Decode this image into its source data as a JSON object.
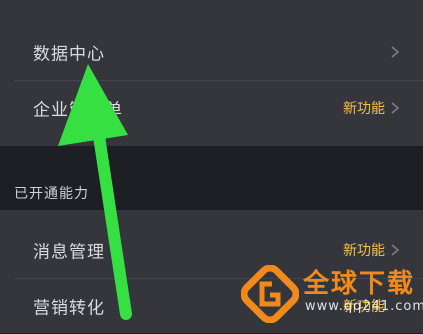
{
  "settings_group_1": {
    "items": [
      {
        "label": "数据中心",
        "badge": ""
      },
      {
        "label": "企业管理单",
        "badge": "新功能"
      }
    ]
  },
  "section_title": "已开通能力",
  "settings_group_2": {
    "items": [
      {
        "label": "消息管理",
        "badge": "新功能"
      },
      {
        "label": "营销转化",
        "badge": "新功能"
      }
    ]
  },
  "watermark": {
    "title": "全球下载",
    "url": "www.qq241.com"
  },
  "colors": {
    "badge": "#f2c14e",
    "annotation_arrow": "#36e043",
    "watermark_orange": "#f08a1c",
    "panel": "#35363c",
    "background": "#1e1f24"
  },
  "icons": {
    "row_chevron": "chevron-right-icon",
    "overlay_arrow": "annotation-arrow-icon"
  }
}
